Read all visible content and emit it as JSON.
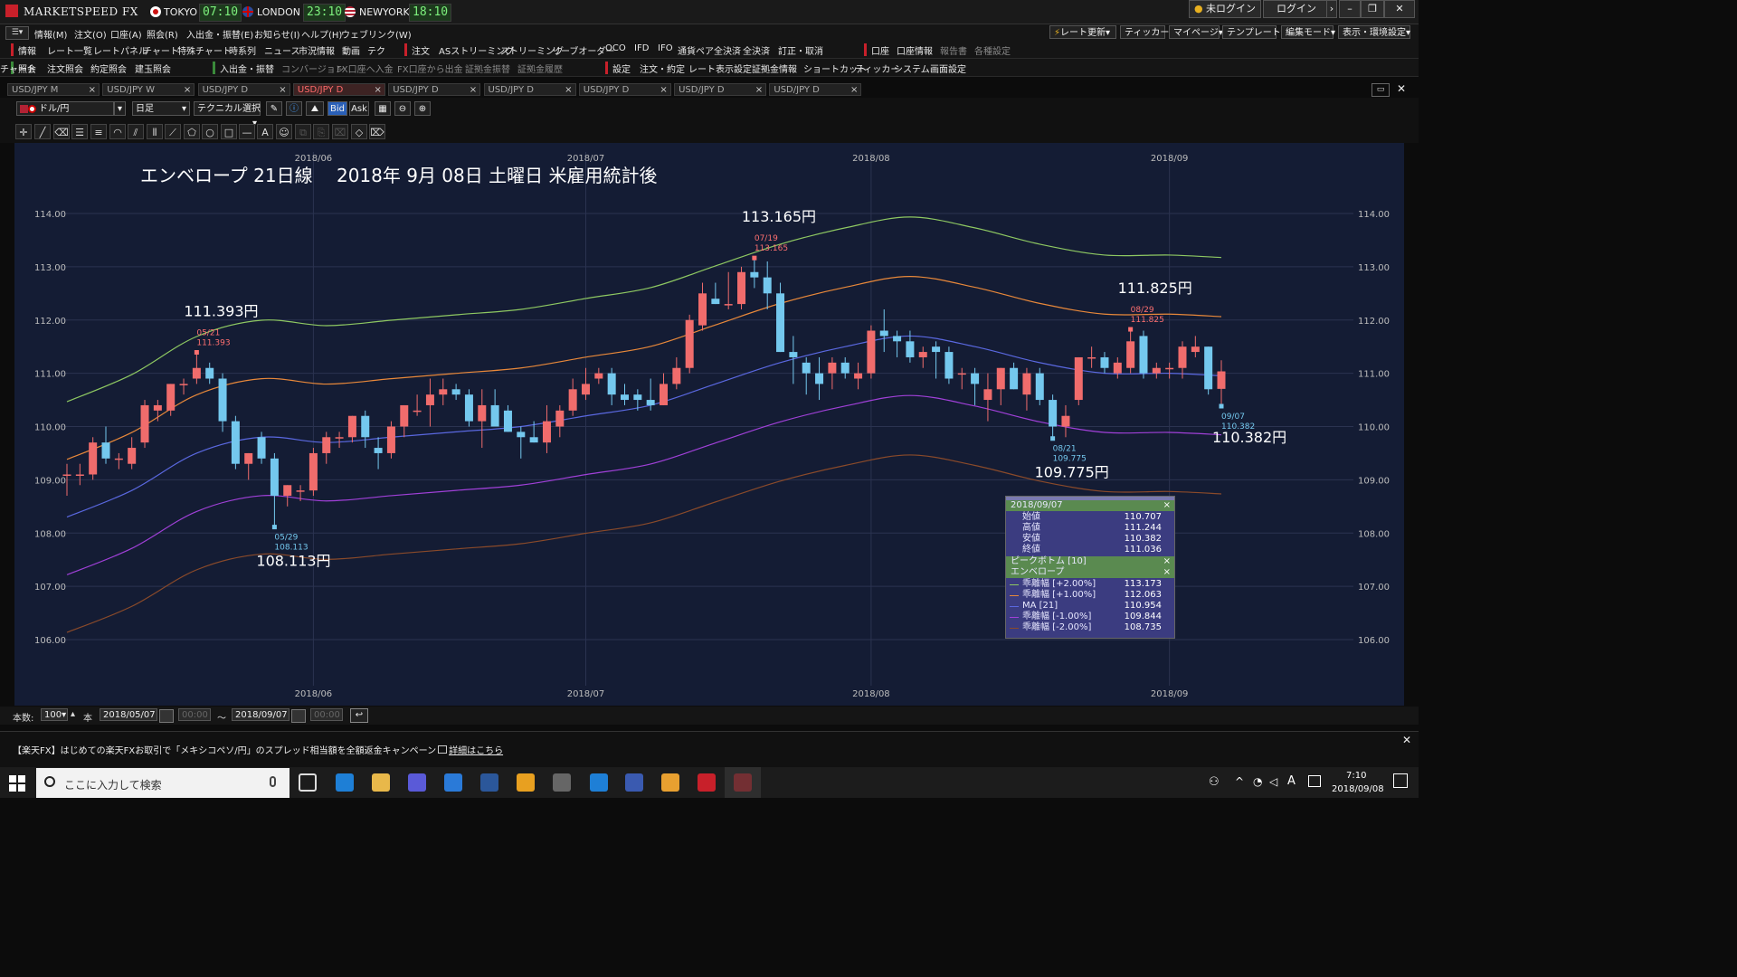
{
  "app": {
    "name": "MARKETSPEED FX",
    "clocks": [
      {
        "city": "TOKYO",
        "time": "07:10",
        "flag_color": "#cc1111"
      },
      {
        "city": "LONDON",
        "time": "23:10",
        "flag_color": "#2c4a9a"
      },
      {
        "city": "NEWYORK",
        "time": "18:10",
        "flag_color": "#b22234"
      }
    ],
    "login_status": "未ログイン",
    "login_button": "ログイン"
  },
  "menubar": [
    "情報(M)",
    "注文(O)",
    "口座(A)",
    "照会(R)",
    "入出金・振替(E)",
    "お知らせ(I)",
    "ヘルプ(H)",
    "ウェブリンク(W)"
  ],
  "top_right_buttons": [
    "レート更新",
    "ティッカー",
    "マイページ",
    "テンプレート",
    "編集モード",
    "表示・環境設定"
  ],
  "toolbar1": {
    "group1_label": "情報",
    "group1": [
      "レート一覧",
      "レートパネル",
      "チャート",
      "特殊チャート",
      "時系列",
      "ニュース",
      "市況情報",
      "動画",
      "テク"
    ],
    "group2_label": "注文",
    "group2": [
      "ASストリーミング",
      "ストリーミング",
      "リーブオーダー",
      "OCO",
      "IFD",
      "IFO",
      "通貨ペア全決済",
      "全決済",
      "訂正・取消"
    ],
    "group3_label": "口座",
    "group3": [
      "口座情報",
      "報告書",
      "各種設定"
    ]
  },
  "toolbar2": {
    "group1_label": "照会",
    "group1": [
      "注文照会",
      "約定照会",
      "建玉照会"
    ],
    "group2_label": "入出金・振替",
    "group2": [
      "コンバージョン",
      "FX口座へ入金",
      "FX口座から出金",
      "証拠金振替",
      "証拠金履歴"
    ],
    "group3_label": "設定",
    "group3": [
      "注文・約定",
      "レート表示設定",
      "証拠金情報",
      "ショートカット",
      "ティッカー",
      "システム",
      "画面設定",
      "チャート"
    ]
  },
  "tabs": [
    "USD/JPY M",
    "USD/JPY W",
    "USD/JPY D",
    "USD/JPY D",
    "USD/JPY D",
    "USD/JPY D",
    "USD/JPY D",
    "USD/JPY D",
    "USD/JPY D"
  ],
  "active_tab_index": 3,
  "chart_toolbar": {
    "pair": "ドル/円",
    "timeframe": "日足",
    "technical": "テクニカル選択",
    "bid": "Bid",
    "ask": "Ask"
  },
  "chart_data": {
    "type": "candlestick",
    "title": "エンベロープ 21日線　 2018年 9月 08日 土曜日 米雇用統計後",
    "x_tick_labels": [
      "2018/06",
      "2018/07",
      "2018/08",
      "2018/09"
    ],
    "x_tick_dates": [
      "2018-06-01",
      "2018-07-02",
      "2018-08-01",
      "2018-09-03"
    ],
    "y_tick_labels": [
      "114.00",
      "113.00",
      "112.00",
      "111.00",
      "110.00",
      "109.00",
      "108.00",
      "107.00",
      "106.00"
    ],
    "ylim": [
      105.5,
      115.0
    ],
    "grid": true,
    "candles": [
      {
        "date": "2018-05-07",
        "o": 109.1,
        "h": 109.3,
        "l": 108.7,
        "c": 109.1
      },
      {
        "date": "2018-05-08",
        "o": 109.1,
        "h": 109.3,
        "l": 108.9,
        "c": 109.1
      },
      {
        "date": "2018-05-09",
        "o": 109.1,
        "h": 109.8,
        "l": 109.0,
        "c": 109.7
      },
      {
        "date": "2018-05-10",
        "o": 109.7,
        "h": 110.0,
        "l": 109.3,
        "c": 109.4
      },
      {
        "date": "2018-05-11",
        "o": 109.4,
        "h": 109.5,
        "l": 109.2,
        "c": 109.4
      },
      {
        "date": "2018-05-14",
        "o": 109.3,
        "h": 109.8,
        "l": 109.2,
        "c": 109.6
      },
      {
        "date": "2018-05-15",
        "o": 109.7,
        "h": 110.5,
        "l": 109.6,
        "c": 110.4
      },
      {
        "date": "2018-05-16",
        "o": 110.3,
        "h": 110.5,
        "l": 110.1,
        "c": 110.4
      },
      {
        "date": "2018-05-17",
        "o": 110.3,
        "h": 110.8,
        "l": 110.2,
        "c": 110.8
      },
      {
        "date": "2018-05-18",
        "o": 110.8,
        "h": 110.9,
        "l": 110.6,
        "c": 110.8
      },
      {
        "date": "2018-05-21",
        "o": 110.9,
        "h": 111.393,
        "l": 110.8,
        "c": 111.1
      },
      {
        "date": "2018-05-22",
        "o": 111.1,
        "h": 111.2,
        "l": 110.8,
        "c": 110.9
      },
      {
        "date": "2018-05-23",
        "o": 110.9,
        "h": 111.0,
        "l": 109.9,
        "c": 110.1
      },
      {
        "date": "2018-05-24",
        "o": 110.1,
        "h": 110.2,
        "l": 109.2,
        "c": 109.3
      },
      {
        "date": "2018-05-25",
        "o": 109.3,
        "h": 109.5,
        "l": 109.0,
        "c": 109.5
      },
      {
        "date": "2018-05-28",
        "o": 109.8,
        "h": 109.9,
        "l": 109.3,
        "c": 109.4
      },
      {
        "date": "2018-05-29",
        "o": 109.4,
        "h": 109.5,
        "l": 108.113,
        "c": 108.7
      },
      {
        "date": "2018-05-30",
        "o": 108.7,
        "h": 108.9,
        "l": 108.5,
        "c": 108.9
      },
      {
        "date": "2018-05-31",
        "o": 108.8,
        "h": 108.9,
        "l": 108.6,
        "c": 108.8
      },
      {
        "date": "2018-06-01",
        "o": 108.8,
        "h": 109.6,
        "l": 108.7,
        "c": 109.5
      },
      {
        "date": "2018-06-04",
        "o": 109.5,
        "h": 109.9,
        "l": 109.3,
        "c": 109.8
      },
      {
        "date": "2018-06-05",
        "o": 109.8,
        "h": 109.9,
        "l": 109.6,
        "c": 109.8
      },
      {
        "date": "2018-06-06",
        "o": 109.8,
        "h": 110.2,
        "l": 109.7,
        "c": 110.2
      },
      {
        "date": "2018-06-07",
        "o": 110.2,
        "h": 110.3,
        "l": 109.6,
        "c": 109.8
      },
      {
        "date": "2018-06-08",
        "o": 109.6,
        "h": 109.8,
        "l": 109.2,
        "c": 109.5
      },
      {
        "date": "2018-06-11",
        "o": 109.5,
        "h": 110.1,
        "l": 109.4,
        "c": 110.0
      },
      {
        "date": "2018-06-12",
        "o": 110.0,
        "h": 110.4,
        "l": 109.8,
        "c": 110.4
      },
      {
        "date": "2018-06-13",
        "o": 110.3,
        "h": 110.6,
        "l": 110.2,
        "c": 110.3
      },
      {
        "date": "2018-06-14",
        "o": 110.4,
        "h": 110.9,
        "l": 110.0,
        "c": 110.6
      },
      {
        "date": "2018-06-15",
        "o": 110.6,
        "h": 110.9,
        "l": 110.4,
        "c": 110.7
      },
      {
        "date": "2018-06-18",
        "o": 110.7,
        "h": 110.8,
        "l": 110.5,
        "c": 110.6
      },
      {
        "date": "2018-06-19",
        "o": 110.6,
        "h": 110.7,
        "l": 110.0,
        "c": 110.1
      },
      {
        "date": "2018-06-20",
        "o": 110.1,
        "h": 110.7,
        "l": 109.6,
        "c": 110.4
      },
      {
        "date": "2018-06-21",
        "o": 110.4,
        "h": 110.7,
        "l": 110.0,
        "c": 110.0
      },
      {
        "date": "2018-06-22",
        "o": 110.3,
        "h": 110.4,
        "l": 109.9,
        "c": 109.9
      },
      {
        "date": "2018-06-25",
        "o": 109.9,
        "h": 110.0,
        "l": 109.4,
        "c": 109.8
      },
      {
        "date": "2018-06-26",
        "o": 109.8,
        "h": 110.1,
        "l": 109.7,
        "c": 109.7
      },
      {
        "date": "2018-06-27",
        "o": 109.7,
        "h": 110.4,
        "l": 109.5,
        "c": 110.1
      },
      {
        "date": "2018-06-28",
        "o": 110.0,
        "h": 110.4,
        "l": 109.8,
        "c": 110.3
      },
      {
        "date": "2018-06-29",
        "o": 110.3,
        "h": 110.9,
        "l": 110.2,
        "c": 110.7
      },
      {
        "date": "2018-07-02",
        "o": 110.6,
        "h": 111.1,
        "l": 110.5,
        "c": 110.8
      },
      {
        "date": "2018-07-03",
        "o": 110.9,
        "h": 111.1,
        "l": 110.8,
        "c": 111.0
      },
      {
        "date": "2018-07-04",
        "o": 111.0,
        "h": 111.1,
        "l": 110.4,
        "c": 110.6
      },
      {
        "date": "2018-07-05",
        "o": 110.6,
        "h": 110.8,
        "l": 110.4,
        "c": 110.5
      },
      {
        "date": "2018-07-06",
        "o": 110.6,
        "h": 110.7,
        "l": 110.3,
        "c": 110.5
      },
      {
        "date": "2018-07-09",
        "o": 110.5,
        "h": 110.9,
        "l": 110.3,
        "c": 110.4
      },
      {
        "date": "2018-07-10",
        "o": 110.4,
        "h": 111.0,
        "l": 110.4,
        "c": 110.8
      },
      {
        "date": "2018-07-11",
        "o": 110.8,
        "h": 111.3,
        "l": 110.7,
        "c": 111.1
      },
      {
        "date": "2018-07-12",
        "o": 111.1,
        "h": 112.1,
        "l": 111.0,
        "c": 112.0
      },
      {
        "date": "2018-07-13",
        "o": 111.9,
        "h": 112.7,
        "l": 111.8,
        "c": 112.5
      },
      {
        "date": "2018-07-16",
        "o": 112.4,
        "h": 112.7,
        "l": 112.3,
        "c": 112.3
      },
      {
        "date": "2018-07-17",
        "o": 112.3,
        "h": 112.9,
        "l": 112.2,
        "c": 112.3
      },
      {
        "date": "2018-07-18",
        "o": 112.3,
        "h": 113.0,
        "l": 112.2,
        "c": 112.9
      },
      {
        "date": "2018-07-19",
        "o": 112.9,
        "h": 113.165,
        "l": 112.6,
        "c": 112.8
      },
      {
        "date": "2018-07-20",
        "o": 112.8,
        "h": 113.1,
        "l": 112.2,
        "c": 112.5
      },
      {
        "date": "2018-07-23",
        "o": 112.5,
        "h": 112.7,
        "l": 111.4,
        "c": 111.4
      },
      {
        "date": "2018-07-24",
        "o": 111.4,
        "h": 111.7,
        "l": 110.8,
        "c": 111.3
      },
      {
        "date": "2018-07-25",
        "o": 111.2,
        "h": 111.3,
        "l": 110.6,
        "c": 111.0
      },
      {
        "date": "2018-07-26",
        "o": 111.0,
        "h": 111.3,
        "l": 110.5,
        "c": 110.8
      },
      {
        "date": "2018-07-27",
        "o": 111.0,
        "h": 111.3,
        "l": 110.7,
        "c": 111.2
      },
      {
        "date": "2018-07-30",
        "o": 111.2,
        "h": 111.3,
        "l": 110.9,
        "c": 111.0
      },
      {
        "date": "2018-07-31",
        "o": 110.9,
        "h": 111.2,
        "l": 110.7,
        "c": 111.0
      },
      {
        "date": "2018-08-01",
        "o": 111.0,
        "h": 111.9,
        "l": 110.9,
        "c": 111.8
      },
      {
        "date": "2018-08-02",
        "o": 111.8,
        "h": 112.2,
        "l": 111.4,
        "c": 111.7
      },
      {
        "date": "2018-08-03",
        "o": 111.7,
        "h": 111.8,
        "l": 111.3,
        "c": 111.6
      },
      {
        "date": "2018-08-06",
        "o": 111.6,
        "h": 111.8,
        "l": 111.2,
        "c": 111.3
      },
      {
        "date": "2018-08-07",
        "o": 111.3,
        "h": 111.5,
        "l": 111.1,
        "c": 111.4
      },
      {
        "date": "2018-08-08",
        "o": 111.5,
        "h": 111.6,
        "l": 110.9,
        "c": 111.4
      },
      {
        "date": "2018-08-09",
        "o": 111.4,
        "h": 111.5,
        "l": 110.8,
        "c": 110.9
      },
      {
        "date": "2018-08-10",
        "o": 111.0,
        "h": 111.1,
        "l": 110.7,
        "c": 111.0
      },
      {
        "date": "2018-08-13",
        "o": 111.0,
        "h": 111.1,
        "l": 110.4,
        "c": 110.8
      },
      {
        "date": "2018-08-14",
        "o": 110.5,
        "h": 111.0,
        "l": 110.1,
        "c": 110.7
      },
      {
        "date": "2018-08-15",
        "o": 110.7,
        "h": 111.1,
        "l": 110.4,
        "c": 111.1
      },
      {
        "date": "2018-08-16",
        "o": 111.1,
        "h": 111.2,
        "l": 110.7,
        "c": 110.7
      },
      {
        "date": "2018-08-17",
        "o": 110.6,
        "h": 111.1,
        "l": 110.3,
        "c": 111.0
      },
      {
        "date": "2018-08-20",
        "o": 111.0,
        "h": 111.1,
        "l": 110.4,
        "c": 110.5
      },
      {
        "date": "2018-08-21",
        "o": 110.5,
        "h": 110.6,
        "l": 109.775,
        "c": 110.0
      },
      {
        "date": "2018-08-22",
        "o": 110.0,
        "h": 110.4,
        "l": 109.8,
        "c": 110.2
      },
      {
        "date": "2018-08-23",
        "o": 110.5,
        "h": 111.3,
        "l": 110.4,
        "c": 111.3
      },
      {
        "date": "2018-08-24",
        "o": 111.3,
        "h": 111.5,
        "l": 111.1,
        "c": 111.3
      },
      {
        "date": "2018-08-27",
        "o": 111.3,
        "h": 111.4,
        "l": 111.0,
        "c": 111.1
      },
      {
        "date": "2018-08-28",
        "o": 111.0,
        "h": 111.3,
        "l": 110.9,
        "c": 111.2
      },
      {
        "date": "2018-08-29",
        "o": 111.1,
        "h": 111.825,
        "l": 111.0,
        "c": 111.6
      },
      {
        "date": "2018-08-30",
        "o": 111.7,
        "h": 111.8,
        "l": 110.9,
        "c": 111.0
      },
      {
        "date": "2018-08-31",
        "o": 111.0,
        "h": 111.2,
        "l": 110.9,
        "c": 111.1
      },
      {
        "date": "2018-09-03",
        "o": 111.1,
        "h": 111.2,
        "l": 110.9,
        "c": 111.1
      },
      {
        "date": "2018-09-04",
        "o": 111.1,
        "h": 111.6,
        "l": 110.9,
        "c": 111.5
      },
      {
        "date": "2018-09-05",
        "o": 111.4,
        "h": 111.7,
        "l": 111.3,
        "c": 111.5
      },
      {
        "date": "2018-09-06",
        "o": 111.5,
        "h": 111.5,
        "l": 110.6,
        "c": 110.7
      },
      {
        "date": "2018-09-07",
        "o": 110.707,
        "h": 111.244,
        "l": 110.382,
        "c": 111.036
      }
    ],
    "envelope": {
      "dates": [
        "2018-05-07",
        "2018-05-14",
        "2018-05-21",
        "2018-05-28",
        "2018-06-04",
        "2018-06-11",
        "2018-06-18",
        "2018-06-25",
        "2018-07-02",
        "2018-07-09",
        "2018-07-16",
        "2018-07-23",
        "2018-07-30",
        "2018-08-06",
        "2018-08-13",
        "2018-08-20",
        "2018-08-27",
        "2018-09-03",
        "2018-09-07"
      ],
      "ma": [
        108.3,
        108.8,
        109.5,
        109.8,
        109.7,
        109.8,
        109.9,
        110.0,
        110.2,
        110.4,
        110.8,
        111.2,
        111.5,
        111.7,
        111.5,
        111.2,
        111.0,
        111.0,
        110.954
      ],
      "lines": [
        {
          "label": "乖離幅 [+2.00%]",
          "pct": 2.0,
          "color": "#8ec862"
        },
        {
          "label": "乖離幅 [+1.00%]",
          "pct": 1.0,
          "color": "#e8883a"
        },
        {
          "label": "MA [21]",
          "pct": 0.0,
          "color": "#5a68e0"
        },
        {
          "label": "乖離幅 [-1.00%]",
          "pct": -1.0,
          "color": "#a040d8"
        },
        {
          "label": "乖離幅 [-2.00%]",
          "pct": -2.0,
          "color": "#8a4a2a"
        }
      ]
    },
    "peaks": [
      {
        "kind": "high",
        "date": "2018-05-21",
        "price": 111.393,
        "label_small_date": "05/21",
        "label_small_price": "111.393",
        "label_big": "111.393円"
      },
      {
        "kind": "low",
        "date": "2018-05-29",
        "price": 108.113,
        "label_small_date": "05/29",
        "label_small_price": "108.113",
        "label_big": "108.113円"
      },
      {
        "kind": "high",
        "date": "2018-07-19",
        "price": 113.165,
        "label_small_date": "07/19",
        "label_small_price": "113.165",
        "label_big": "113.165円"
      },
      {
        "kind": "low",
        "date": "2018-08-21",
        "price": 109.775,
        "label_small_date": "08/21",
        "label_small_price": "109.775",
        "label_big": "109.775円"
      },
      {
        "kind": "high",
        "date": "2018-08-29",
        "price": 111.825,
        "label_small_date": "08/29",
        "label_small_price": "111.825",
        "label_big": "111.825円"
      },
      {
        "kind": "low",
        "date": "2018-09-07",
        "price": 110.382,
        "label_small_date": "09/07",
        "label_small_price": "110.382",
        "label_big": "110.382円"
      }
    ],
    "colors": {
      "up": "#f06c6c",
      "down": "#74c8ee",
      "background": "#141c34",
      "grid": "#2b3350",
      "axis_text": "#bdbdbd"
    }
  },
  "infobox": {
    "date": "2018/09/07",
    "ohlc": [
      {
        "label": "始値",
        "value": "110.707"
      },
      {
        "label": "高値",
        "value": "111.244"
      },
      {
        "label": "安値",
        "value": "110.382"
      },
      {
        "label": "終値",
        "value": "111.036"
      }
    ],
    "section1": "ピークボトム [10]",
    "section2": "エンベロープ",
    "envelope_rows": [
      {
        "label": "乖離幅 [+2.00%]",
        "value": "113.173",
        "color": "#8ec862"
      },
      {
        "label": "乖離幅 [+1.00%]",
        "value": "112.063",
        "color": "#e8883a"
      },
      {
        "label": "MA [21]",
        "value": "110.954",
        "color": "#5a68e0"
      },
      {
        "label": "乖離幅 [-1.00%]",
        "value": "109.844",
        "color": "#a040d8"
      },
      {
        "label": "乖離幅 [-2.00%]",
        "value": "108.735",
        "color": "#8a4a2a"
      }
    ]
  },
  "bottom": {
    "count_label": "本数:",
    "count_value": "100",
    "unit": "本",
    "from_date": "2018/05/07",
    "from_time": "00:00",
    "tilde": "～",
    "to_date": "2018/09/07",
    "to_time": "00:00"
  },
  "promo": {
    "text": "【楽天FX】はじめての楽天FXお取引で「メキシコペソ/円」のスプレッド相当額を全額返金キャンペーン",
    "link": "詳細はこちら"
  },
  "taskbar": {
    "search_placeholder": "ここに入力して検索",
    "time": "7:10",
    "date": "2018/09/08"
  }
}
